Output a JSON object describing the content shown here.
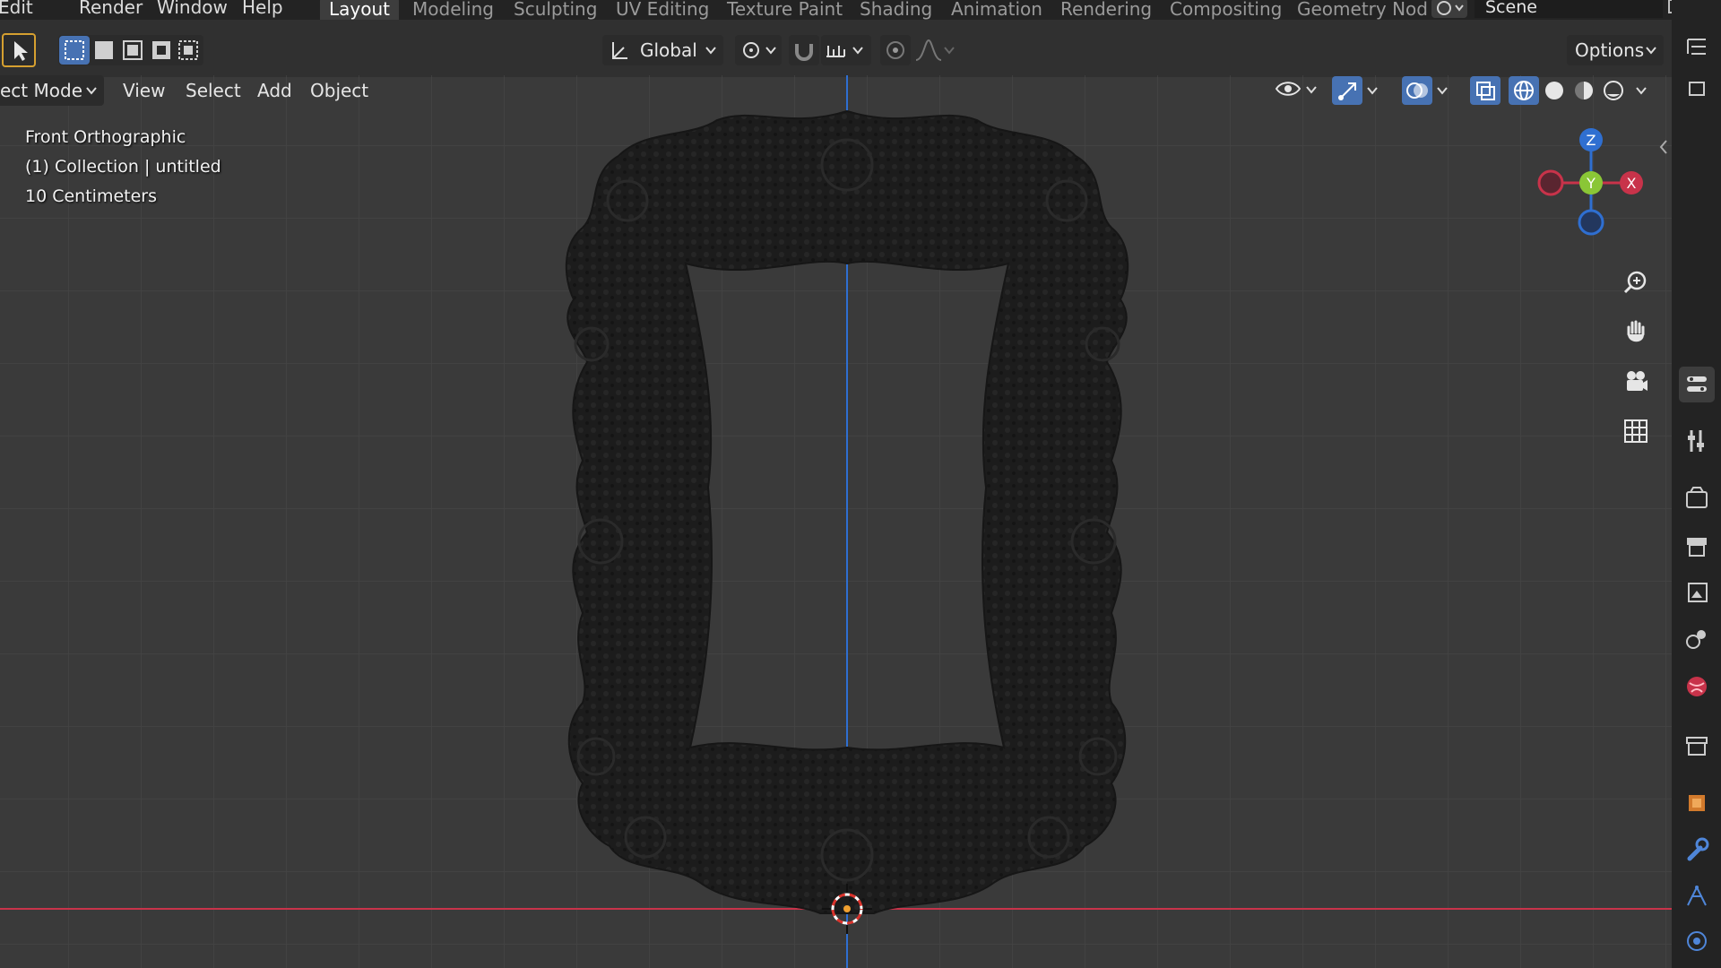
{
  "menu": {
    "items": [
      "Edit",
      "Render",
      "Window",
      "Help"
    ]
  },
  "workspaces": {
    "tabs": [
      "Layout",
      "Modeling",
      "Sculpting",
      "UV Editing",
      "Texture Paint",
      "Shading",
      "Animation",
      "Rendering",
      "Compositing",
      "Geometry Nod"
    ],
    "active": "Layout"
  },
  "scene": {
    "name": "Scene"
  },
  "toolheader": {
    "transform_orientation": "Global",
    "options_label": "Options"
  },
  "viewport_header": {
    "mode_label": "ect Mode",
    "menus": [
      "View",
      "Select",
      "Add",
      "Object"
    ]
  },
  "overlay": {
    "view_name": "Front Orthographic",
    "collection": "(1) Collection | untitled",
    "grid_scale": "10 Centimeters"
  },
  "gizmo": {
    "axes": [
      "Z",
      "Y",
      "X"
    ]
  },
  "colors": {
    "x_axis": "#c8334a",
    "y_axis": "#8ac636",
    "z_axis": "#2f6fd1",
    "accent": "#4772b3"
  }
}
